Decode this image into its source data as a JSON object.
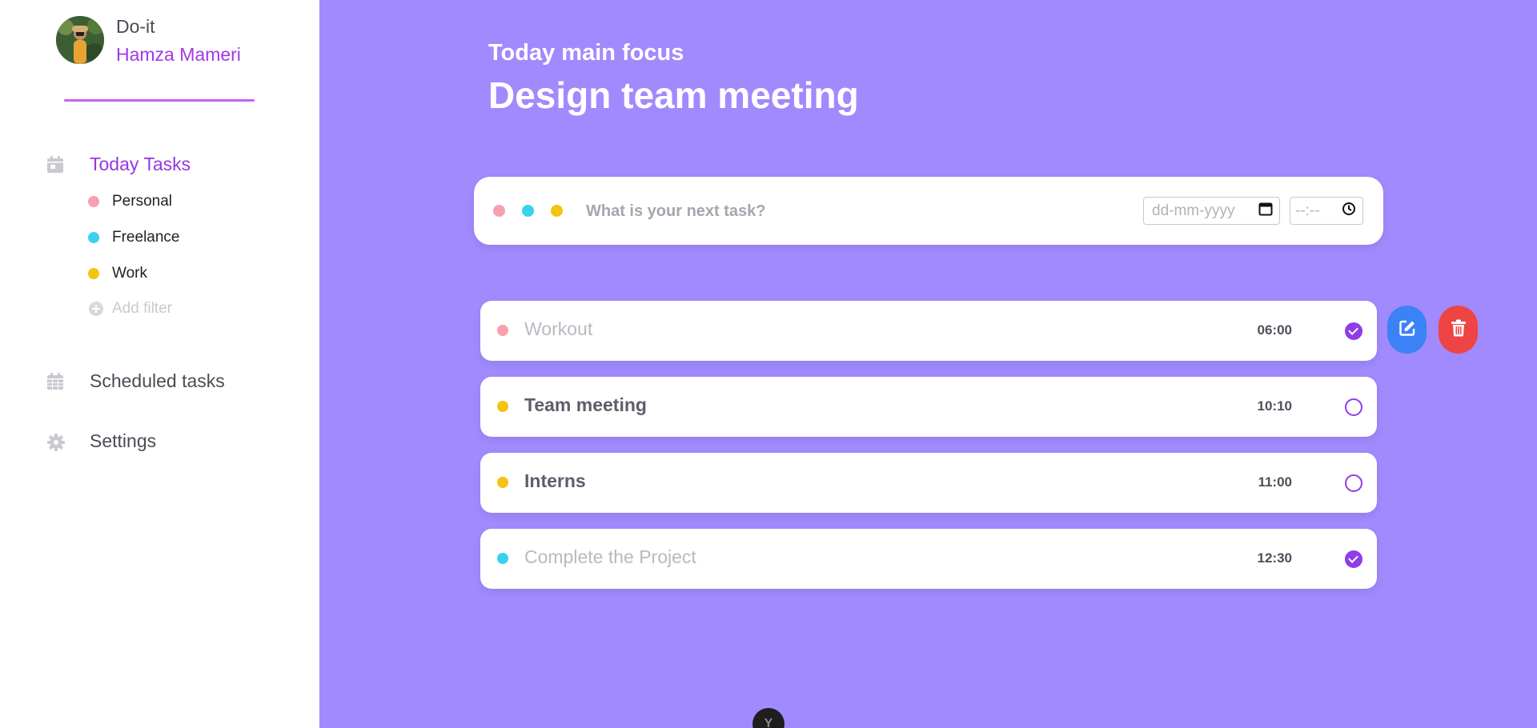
{
  "profile": {
    "app_name": "Do-it",
    "user_name": "Hamza Mameri"
  },
  "nav": {
    "today": {
      "label": "Today Tasks",
      "icon": "calendar-day-icon"
    },
    "scheduled": {
      "label": "Scheduled tasks",
      "icon": "calendar-grid-icon"
    },
    "settings": {
      "label": "Settings",
      "icon": "gear-icon"
    }
  },
  "filters": [
    {
      "label": "Personal",
      "color": "#f7a0ae"
    },
    {
      "label": "Freelance",
      "color": "#38d2ef"
    },
    {
      "label": "Work",
      "color": "#f5c310"
    }
  ],
  "add_filter": {
    "label": "Add filter",
    "icon": "plus-circle-icon"
  },
  "focus": {
    "subtitle": "Today main focus",
    "title": "Design team meeting"
  },
  "new_task": {
    "placeholder": "What is your next task?",
    "date_placeholder": "dd-mm-yyyy",
    "time_placeholder": "--:--",
    "dot_colors": [
      "#f7a0ae",
      "#38d2ef",
      "#f5c310"
    ]
  },
  "tasks": [
    {
      "title": "Workout",
      "time": "06:00",
      "color": "#f7a0ae",
      "done": true
    },
    {
      "title": "Team meeting",
      "time": "10:10",
      "color": "#f5c310",
      "done": false
    },
    {
      "title": "Interns",
      "time": "11:00",
      "color": "#f5c310",
      "done": false
    },
    {
      "title": "Complete the Project",
      "time": "12:30",
      "color": "#38d2ef",
      "done": true
    }
  ],
  "actions": {
    "edit_icon": "edit-icon",
    "delete_icon": "trash-icon"
  },
  "bottom_badge": "Y",
  "colors": {
    "background": "#a08afd",
    "accent": "#9636e4"
  }
}
